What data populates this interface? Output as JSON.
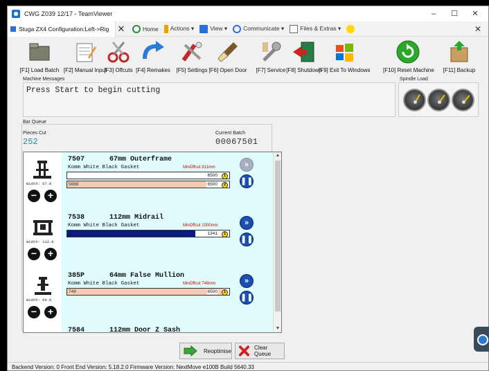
{
  "window": {
    "title": "CWG Z039 12/17 - TeamViewer",
    "minimize": "–",
    "maximize": "☐",
    "close": "✕"
  },
  "teamviewer_bar": {
    "tab_label": "Stuga ZX4   Configuration:Left->Rig",
    "tab_close": "✕",
    "home": "Home",
    "actions": "Actions ▾",
    "view": "View ▾",
    "communicate": "Communicate ▾",
    "files": "Files & Extras ▾",
    "close": "✕"
  },
  "toolbar": [
    {
      "key": "load-batch",
      "label": "[F1] Load Batch",
      "icon": "folder-icon"
    },
    {
      "key": "manual-input",
      "label": "[F2] Manual Input",
      "icon": "notepad-icon"
    },
    {
      "key": "offcuts",
      "label": "[F3] Offcuts",
      "icon": "scissors-icon"
    },
    {
      "key": "remakes",
      "label": "[F4] Remakes",
      "icon": "redo-arrow-icon"
    },
    {
      "key": "settings",
      "label": "[F5] Settings",
      "icon": "tools-icon"
    },
    {
      "key": "open-door",
      "label": "[F6] Open Door",
      "icon": "brush-icon"
    },
    {
      "key": "service",
      "label": "[F7] Service",
      "icon": "wrench-icon"
    },
    {
      "key": "shutdown",
      "label": "[F8] Shutdown",
      "icon": "exit-door-icon"
    },
    {
      "key": "exit-windows",
      "label": "[F9] Exit To Windows",
      "icon": "windows-logo-icon"
    },
    {
      "key": "reset-machine",
      "label": "[F10] Reset Machine",
      "icon": "reset-icon"
    },
    {
      "key": "backup",
      "label": "[F11] Backup",
      "icon": "backup-box-icon"
    }
  ],
  "machine_messages": {
    "label": "Machine Messages",
    "text": "Press Start to begin cutting"
  },
  "spindle": {
    "label": "Spindle Load"
  },
  "bar_queue": {
    "label": "Bar Queue",
    "pieces_cut_label": "Pieces Cut",
    "pieces_cut": "252",
    "current_batch_label": "Current Batch",
    "current_batch": "00067501",
    "items": [
      {
        "code": "7507",
        "name": "67mm Outerframe",
        "desc": "Komm White Black Gasket",
        "min_offcut": "MinOffcut 911mm",
        "width": "Width: 67.0",
        "bar1": {
          "right": "6500",
          "badge": "1",
          "left": "",
          "color": "#0a1a80",
          "fraction": 0.0
        },
        "bar2": {
          "right": "6500",
          "badge": "2",
          "left": "5688",
          "color": "#f7cbb3",
          "fraction": 0.86
        },
        "side_top": "»",
        "side_bottom": "❚❚"
      },
      {
        "code": "7538",
        "name": "112mm Midrail",
        "desc": "Komm White Black Gasket",
        "min_offcut": "MinOffcut 1000mm",
        "width": "Width: 112.0",
        "bar1": {
          "right": "1341",
          "badge": "1",
          "left": "",
          "color": "#0a1a80",
          "fraction": 0.79
        },
        "side_top": "»",
        "side_bottom": "❚❚"
      },
      {
        "code": "385P",
        "name": "64mm False Mullion",
        "desc": "Komm White Black Gasket",
        "min_offcut": "MinOffcut 749mm",
        "width": "Width: 64.0",
        "bar1": {
          "right": "6500",
          "badge": "1",
          "left": "749",
          "color": "#f7cbb3",
          "fraction": 0.96
        },
        "side_top": "»",
        "side_bottom": "❚❚"
      },
      {
        "code": "7584",
        "name": "112mm Door Z Sash"
      }
    ]
  },
  "actions": {
    "reoptimise": "Reoptimise",
    "clear_queue": "Clear Queue"
  },
  "status": {
    "text": "Backend Version: 0  Front End Version: 5.18.2.0  Firmware Version: NextMove e100B Build 5640.33"
  }
}
